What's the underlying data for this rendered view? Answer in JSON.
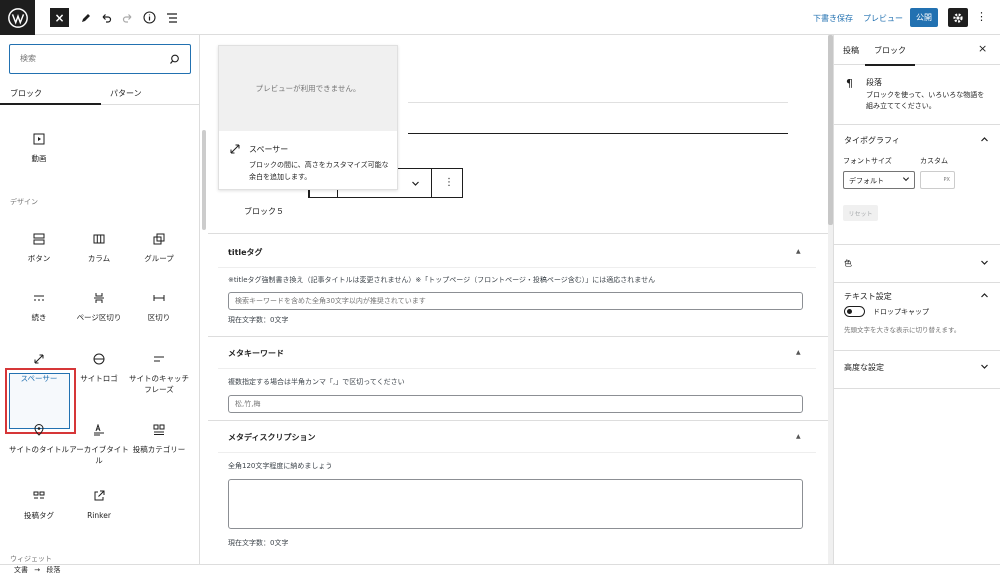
{
  "topbar": {
    "save_draft": "下書き保存",
    "preview": "プレビュー",
    "publish": "公開"
  },
  "inserter": {
    "search_placeholder": "検索",
    "tabs": [
      "ブロック",
      "パターン"
    ],
    "video_label": "動画",
    "design_heading": "デザイン",
    "design_blocks": [
      "ボタン",
      "カラム",
      "グループ",
      "続き",
      "ページ区切り",
      "区切り",
      "スペーサー",
      "サイトロゴ",
      "サイトのキャッチフレーズ",
      "サイトのタイトル",
      "アーカイブタイトル",
      "投稿カテゴリー",
      "投稿タグ",
      "Rinker"
    ],
    "widget_heading": "ウィジェット"
  },
  "preview": {
    "unavailable": "プレビューが利用できません。",
    "title": "スペーサー",
    "desc": "ブロックの間に、高さをカスタマイズ可能な余白を追加します。"
  },
  "canvas": {
    "block_label": "ブロック５"
  },
  "meta": {
    "title_tag": {
      "heading": "titleタグ",
      "desc": "※titleタグ強制書き換え（記事タイトルは変更されません）※「トップページ（フロントページ・投稿ページ含む）」には適応されません",
      "placeholder": "検索キーワードを含めた全角30文字以内が推奨されています",
      "count": "現在文字数：0文字"
    },
    "keywords": {
      "heading": "メタキーワード",
      "desc": "複数指定する場合は半角カンマ「,」で区切ってください",
      "placeholder": "松,竹,梅"
    },
    "description": {
      "heading": "メタディスクリプション",
      "desc": "全角120文字程度に納めましょう",
      "count": "現在文字数：0文字"
    }
  },
  "settings": {
    "tabs": [
      "投稿",
      "ブロック"
    ],
    "block_title": "段落",
    "block_desc": "ブロックを使って、いろいろな物語を組み立ててください。",
    "typography": "タイポグラフィ",
    "font_size_label": "フォントサイズ",
    "custom_label": "カスタム",
    "font_size_value": "デフォルト",
    "px_unit": "PX",
    "reset": "リセット",
    "color": "色",
    "text_settings": "テキスト設定",
    "drop_cap": "ドロップキャップ",
    "drop_cap_desc": "先頭文字を大きな表示に切り替えます。",
    "advanced": "高度な設定"
  },
  "breadcrumb": {
    "root": "文書",
    "arrow": "→",
    "current": "段落"
  },
  "colors": {
    "accent": "#2271b1",
    "highlight": "#d63638",
    "dark": "#1e1e1e"
  }
}
